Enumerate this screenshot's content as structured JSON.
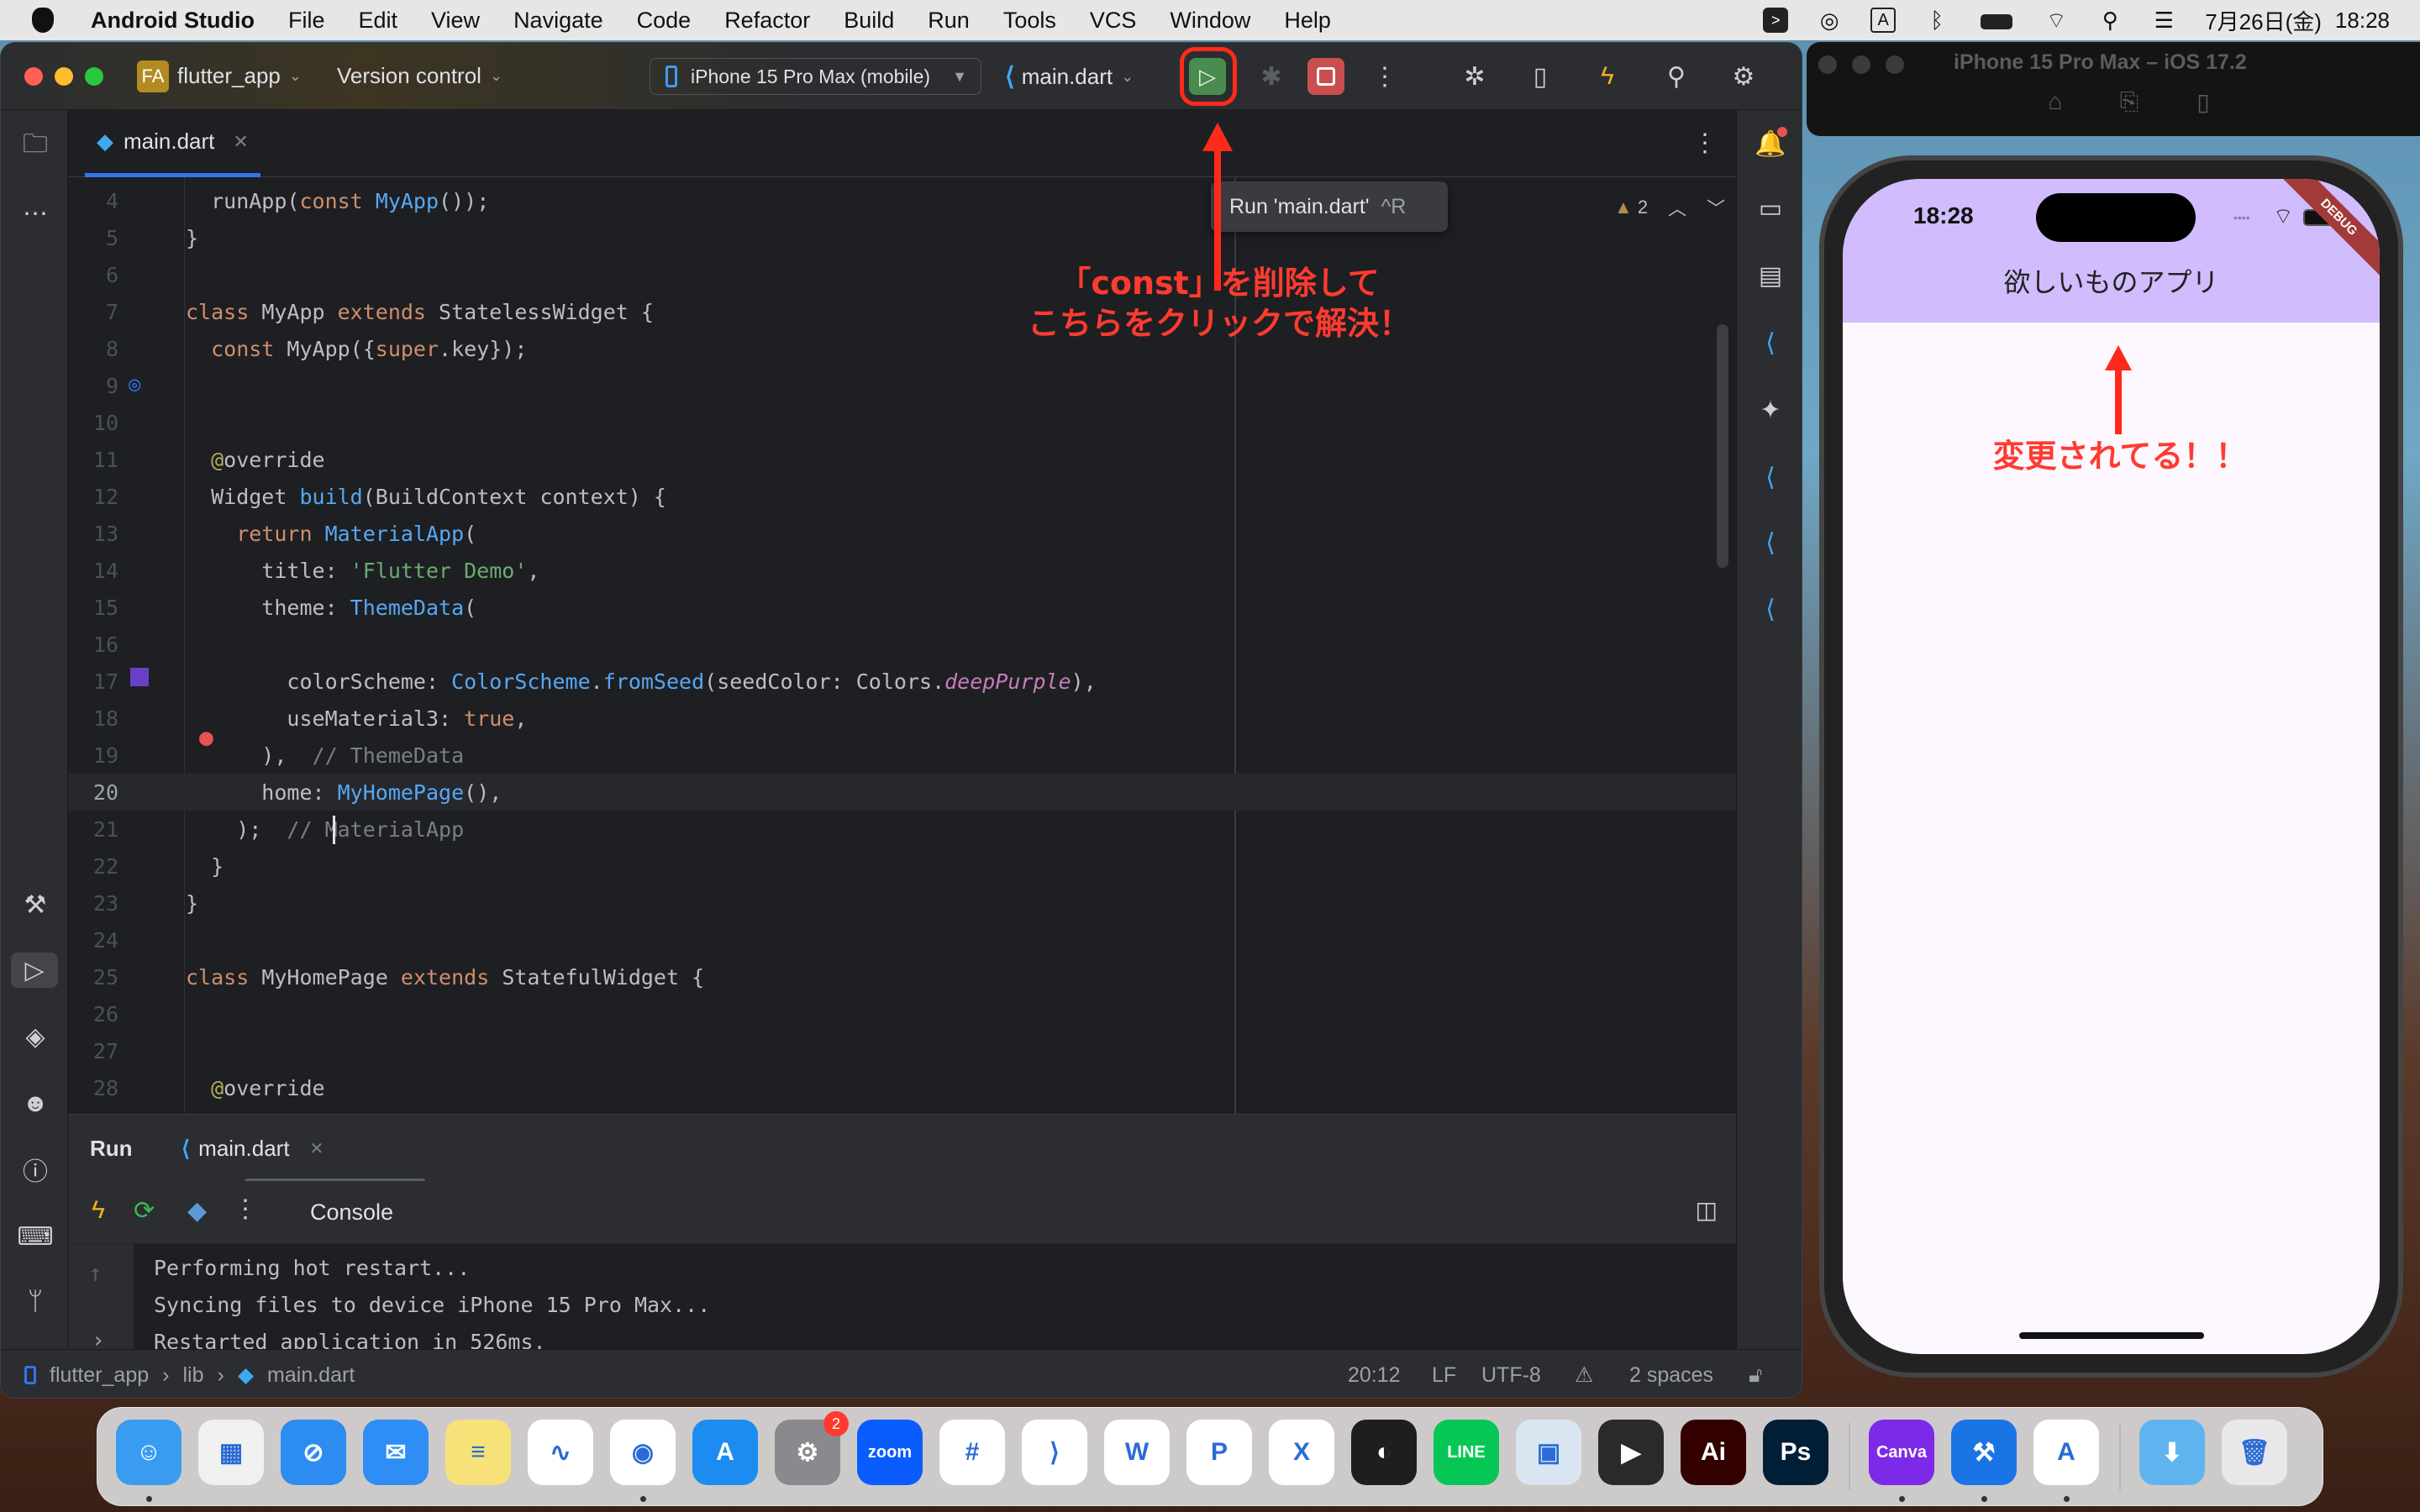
{
  "menubar": {
    "app_name": "Android Studio",
    "items": [
      "File",
      "Edit",
      "View",
      "Navigate",
      "Code",
      "Refactor",
      "Build",
      "Run",
      "Tools",
      "VCS",
      "Window",
      "Help"
    ],
    "datetime": "7月26日(金)",
    "clock": "18:28",
    "input_mode": "A"
  },
  "ide": {
    "project_badge": "FA",
    "project_name": "flutter_app",
    "version_control": "Version control",
    "device": "iPhone 15 Pro Max (mobile)",
    "run_config": "main.dart",
    "tooltip": {
      "label": "Run 'main.dart'",
      "shortcut": "^R"
    },
    "editor_tab": "main.dart",
    "warnings_count": "2",
    "code_lines": [
      {
        "n": "4",
        "tokens": [
          [
            "ty",
            "  runApp("
          ],
          [
            "kw",
            "const "
          ],
          [
            "cls",
            "MyApp"
          ],
          [
            "ty",
            "());"
          ]
        ]
      },
      {
        "n": "5",
        "tokens": [
          [
            "ty",
            "}"
          ]
        ]
      },
      {
        "n": "6",
        "tokens": []
      },
      {
        "n": "7",
        "tokens": [
          [
            "kw",
            "class "
          ],
          [
            "ty",
            "MyApp "
          ],
          [
            "kw",
            "extends "
          ],
          [
            "ty",
            "StatelessWidget {"
          ]
        ]
      },
      {
        "n": "8",
        "tokens": [
          [
            "kw",
            "  const "
          ],
          [
            "ty",
            "MyApp({"
          ],
          [
            "kw",
            "super"
          ],
          [
            "ty",
            ".key});"
          ]
        ]
      },
      {
        "n": "9",
        "tokens": []
      },
      {
        "n": "10",
        "tokens": []
      },
      {
        "n": "11",
        "tokens": [
          [
            "ann",
            "  @"
          ],
          [
            "ty",
            "override"
          ]
        ]
      },
      {
        "n": "12",
        "tokens": [
          [
            "ty",
            "  Widget "
          ],
          [
            "fn",
            "build"
          ],
          [
            "ty",
            "(BuildContext context) {"
          ]
        ]
      },
      {
        "n": "13",
        "tokens": [
          [
            "kw",
            "    return "
          ],
          [
            "cls",
            "MaterialApp"
          ],
          [
            "ty",
            "("
          ]
        ]
      },
      {
        "n": "14",
        "tokens": [
          [
            "ty",
            "      title: "
          ],
          [
            "str",
            "'Flutter Demo'"
          ],
          [
            "ty",
            ","
          ]
        ]
      },
      {
        "n": "15",
        "tokens": [
          [
            "ty",
            "      theme: "
          ],
          [
            "cls",
            "ThemeData"
          ],
          [
            "ty",
            "("
          ]
        ]
      },
      {
        "n": "16",
        "tokens": []
      },
      {
        "n": "17",
        "tokens": [
          [
            "ty",
            "        colorScheme: "
          ],
          [
            "cls",
            "ColorScheme"
          ],
          [
            "ty",
            "."
          ],
          [
            "fn",
            "fromSeed"
          ],
          [
            "ty",
            "(seedColor: Colors."
          ],
          [
            "it",
            "deepPurple"
          ],
          [
            "ty",
            "),"
          ]
        ]
      },
      {
        "n": "18",
        "tokens": [
          [
            "ty",
            "        useMaterial3: "
          ],
          [
            "kw",
            "true"
          ],
          [
            "ty",
            ","
          ]
        ]
      },
      {
        "n": "19",
        "tokens": [
          [
            "ty",
            "      ),  "
          ],
          [
            "cm",
            "// ThemeData"
          ]
        ]
      },
      {
        "n": "20",
        "tokens": [
          [
            "ty",
            "      home: "
          ],
          [
            "cls",
            "MyHomePage"
          ],
          [
            "ty",
            "(),"
          ]
        ]
      },
      {
        "n": "21",
        "tokens": [
          [
            "ty",
            "    );  "
          ],
          [
            "cm",
            "// MaterialApp"
          ]
        ]
      },
      {
        "n": "22",
        "tokens": [
          [
            "ty",
            "  }"
          ]
        ]
      },
      {
        "n": "23",
        "tokens": [
          [
            "ty",
            "}"
          ]
        ]
      },
      {
        "n": "24",
        "tokens": []
      },
      {
        "n": "25",
        "tokens": [
          [
            "kw",
            "class "
          ],
          [
            "ty",
            "MyHomePage "
          ],
          [
            "kw",
            "extends "
          ],
          [
            "ty",
            "StatefulWidget {"
          ]
        ]
      },
      {
        "n": "26",
        "tokens": []
      },
      {
        "n": "27",
        "tokens": []
      },
      {
        "n": "28",
        "tokens": [
          [
            "ann",
            "  @"
          ],
          [
            "ty",
            "override"
          ]
        ]
      }
    ],
    "current_line": "20",
    "run_panel": {
      "title": "Run",
      "tab": "main.dart",
      "console_label": "Console",
      "output": [
        "Performing hot restart...",
        "Syncing files to device iPhone 15 Pro Max...",
        "Restarted application in 526ms."
      ]
    },
    "statusbar": {
      "breadcrumb": [
        "flutter_app",
        "lib",
        "main.dart"
      ],
      "position": "20:12",
      "line_ending": "LF",
      "encoding": "UTF-8",
      "indent": "2 spaces"
    }
  },
  "annotations": {
    "editor_note_line1": "「const」を削除して",
    "editor_note_line2": "こちらをクリックで解決！",
    "phone_note": "変更されてる！！",
    "color": "#ff2a1a"
  },
  "simulator": {
    "window_title": "iPhone 15 Pro Max – iOS 17.2",
    "status_time": "18:28",
    "app_title": "欲しいものアプリ",
    "debug_banner": "DEBUG",
    "appbar_color": "#d1bcfe"
  },
  "dock": {
    "apps": [
      {
        "name": "Finder",
        "label": "☺",
        "color": "#3a9cf0",
        "running": true
      },
      {
        "name": "Launchpad",
        "label": "▦",
        "color": "#f0f0f0"
      },
      {
        "name": "Safari",
        "label": "⊘",
        "color": "#2d8cf0"
      },
      {
        "name": "Mail",
        "label": "✉",
        "color": "#2f8ef5"
      },
      {
        "name": "Notes",
        "label": "≡",
        "color": "#f7e27a"
      },
      {
        "name": "Freeform",
        "label": "∿",
        "color": "#ffffff"
      },
      {
        "name": "Chrome",
        "label": "◉",
        "color": "#ffffff",
        "running": true
      },
      {
        "name": "App Store",
        "label": "A",
        "color": "#1c8cf0"
      },
      {
        "name": "System Settings",
        "label": "⚙",
        "color": "#8a8a8e",
        "badge": "2"
      },
      {
        "name": "Zoom",
        "label": "zoom",
        "color": "#0b5cff"
      },
      {
        "name": "Slack",
        "label": "#",
        "color": "#ffffff"
      },
      {
        "name": "VS Code",
        "label": "⟩",
        "color": "#ffffff"
      },
      {
        "name": "Word",
        "label": "W",
        "color": "#ffffff"
      },
      {
        "name": "PowerPoint",
        "label": "P",
        "color": "#ffffff"
      },
      {
        "name": "Excel",
        "label": "X",
        "color": "#ffffff"
      },
      {
        "name": "Figma",
        "label": "◐",
        "color": "#1e1e1e"
      },
      {
        "name": "LINE",
        "label": "LINE",
        "color": "#06c755"
      },
      {
        "name": "Preview",
        "label": "▣",
        "color": "#d9e6f2"
      },
      {
        "name": "Final Cut Pro",
        "label": "▶",
        "color": "#2a2a2a"
      },
      {
        "name": "Illustrator",
        "label": "Ai",
        "color": "#330000"
      },
      {
        "name": "Photoshop",
        "label": "Ps",
        "color": "#001e36"
      },
      {
        "name": "Canva",
        "label": "Canva",
        "color": "#7d2ae8",
        "running": true
      },
      {
        "name": "Xcode",
        "label": "⚒",
        "color": "#1b74e4",
        "running": true
      },
      {
        "name": "Android Studio",
        "label": "A",
        "color": "#ffffff",
        "running": true
      },
      {
        "name": "Downloads",
        "label": "⬇",
        "color": "#5fb4f0"
      },
      {
        "name": "Trash",
        "label": "🗑",
        "color": "#e8e8ea"
      }
    ]
  }
}
